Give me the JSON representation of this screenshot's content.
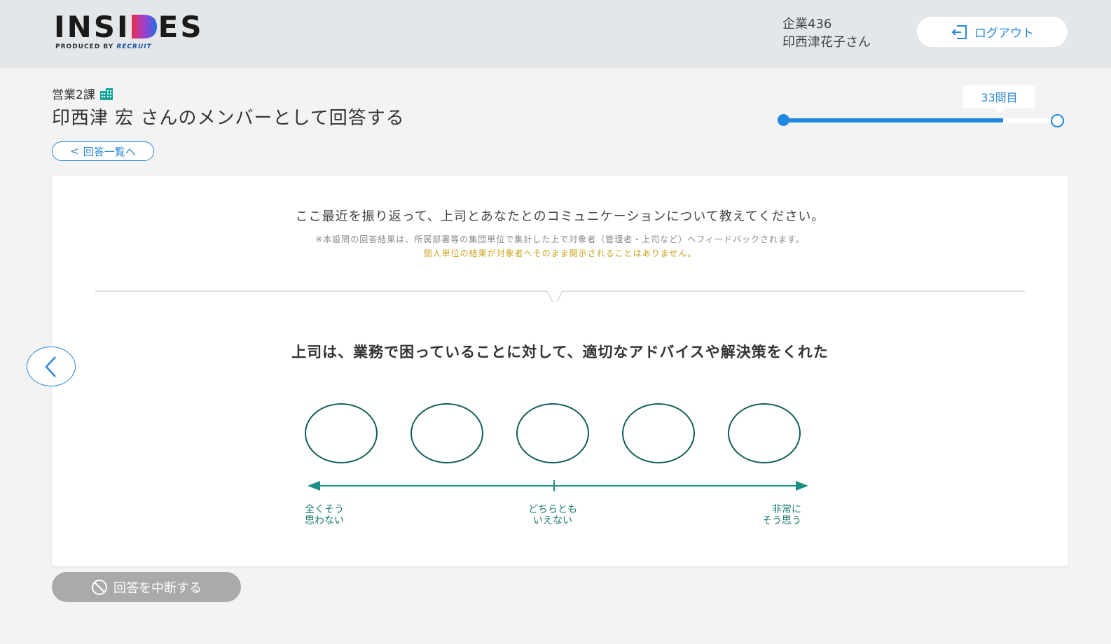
{
  "header": {
    "logo_text": "INSIDES",
    "logo_sub_prefix": "PRODUCED BY ",
    "logo_sub_brand": "RECRUIT",
    "company": "企業436",
    "user_name": "印西津花子さん",
    "logout_label": "ログアウト"
  },
  "context": {
    "department": "営業2課",
    "target_title": "印西津 宏 さんのメンバーとして回答する",
    "back_to_list_label": "回答一覧へ"
  },
  "progress": {
    "badge_label": "33問目",
    "fraction": 0.8
  },
  "question": {
    "intro": "ここ最近を振り返って、上司とあなたとのコミュニケーションについて教えてください。",
    "note": "※本設問の回答結果は、所属部署等の集団単位で集計した上で対象者（管理者・上司など）へフィードバックされます。",
    "note_highlight": "個人単位の結果が対象者へそのまま開示されることはありません。",
    "text": "上司は、業務で困っていることに対して、適切なアドバイスや解決策をくれた",
    "choices": 5,
    "scale_labels": {
      "left_line1": "全くそう",
      "left_line2": "思わない",
      "mid_line1": "どちらとも",
      "mid_line2": "いえない",
      "right_line1": "非常に",
      "right_line2": "そう思う"
    }
  },
  "actions": {
    "suspend_label": "回答を中断する"
  },
  "colors": {
    "accent_blue": "#2a86d8",
    "choice_green": "#155e57",
    "scale_teal": "#1b8f83",
    "note_yellow": "#c8a31f"
  },
  "icons": {
    "logout": "logout-icon",
    "building": "building-icon",
    "prev": "chevron-left-icon",
    "suspend": "prohibit-icon"
  }
}
